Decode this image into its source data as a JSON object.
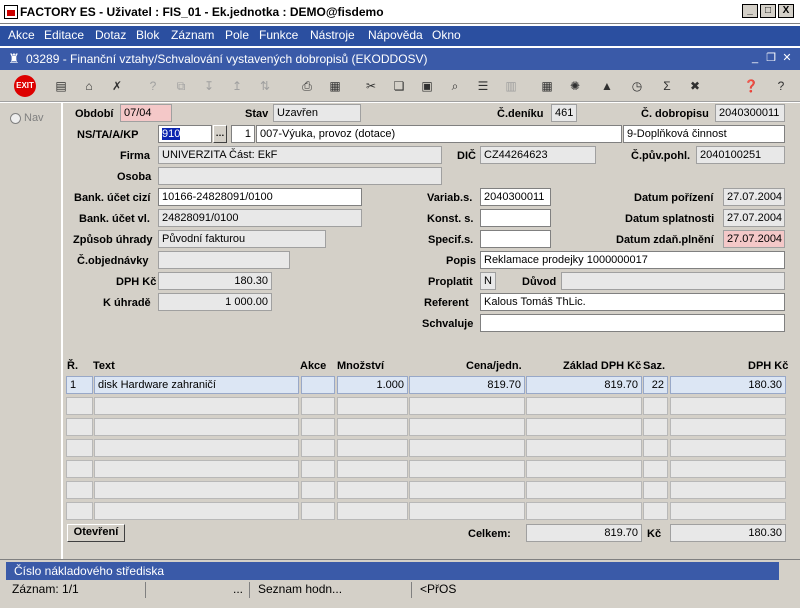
{
  "window": {
    "title": "FACTORY ES - Uživatel : FIS_01 - Ek.jednotka : DEMO@fisdemo",
    "min": "_",
    "max": "□",
    "close": "X"
  },
  "menu": [
    "Akce",
    "Editace",
    "Dotaz",
    "Blok",
    "Záznam",
    "Pole",
    "Funkce",
    "Nástroje",
    "Nápověda",
    "Okno"
  ],
  "doc": {
    "title": "03289 - Finanční vztahy/Schvalování vystavených dobropisů (EKODDOSV)"
  },
  "toolbar": {
    "exit": "EXIT",
    "icons": [
      "add-record-icon",
      "save-icon",
      "delete-record-icon",
      "help-doc-icon",
      "copy-record-icon",
      "sort-asc-icon",
      "sort-desc-icon",
      "sort-icon",
      "print-icon",
      "print-setup-icon",
      "cut-icon",
      "copy-icon",
      "paste-icon",
      "find-icon",
      "list-icon",
      "columns-icon",
      "calculator-icon",
      "settings-icon",
      "chart-icon",
      "calendar-icon",
      "sum-icon",
      "excel-icon",
      "help-icon",
      "context-help-icon"
    ]
  },
  "nav": {
    "label": "Nav"
  },
  "form": {
    "obdobi": {
      "label": "Období",
      "value": "07/04"
    },
    "stav": {
      "label": "Stav",
      "value": "Uzavřen"
    },
    "cdeniku": {
      "label": "Č.deníku",
      "value": "461"
    },
    "cdobropisu": {
      "label": "Č. dobropisu",
      "value": "2040300011"
    },
    "nstakp": {
      "label": "NS/TA/A/KP",
      "ns": "910",
      "dots": "…",
      "ta": "1",
      "a": "007-Výuka, provoz (dotace)",
      "kp": "9-Doplňková činnost"
    },
    "firma": {
      "label": "Firma",
      "value": "UNIVERZITA Část: EkF"
    },
    "dic": {
      "label": "DIČ",
      "value": "CZ44264623"
    },
    "cpuvpohl": {
      "label": "Č.pův.pohl.",
      "value": "2040100251"
    },
    "osoba": {
      "label": "Osoba",
      "value": ""
    },
    "bankcizi": {
      "label": "Bank. účet cizí",
      "value": "10166-24828091/0100"
    },
    "variabs": {
      "label": "Variab.s.",
      "value": "2040300011"
    },
    "datporizeni": {
      "label": "Datum pořízení",
      "value": "27.07.2004"
    },
    "bankvl": {
      "label": "Bank. účet vl.",
      "value": "24828091/0100"
    },
    "konsts": {
      "label": "Konst. s.",
      "value": ""
    },
    "datsplatnosti": {
      "label": "Datum splatnosti",
      "value": "27.07.2004"
    },
    "zpusobuhrady": {
      "label": "Způsob úhrady",
      "value": "Původní fakturou"
    },
    "specifs": {
      "label": "Specif.s.",
      "value": ""
    },
    "datzdan": {
      "label": "Datum zdaň.plnění",
      "value": "27.07.2004"
    },
    "cobjednavky": {
      "label": "Č.objednávky",
      "value": ""
    },
    "popis": {
      "label": "Popis",
      "value": "Reklamace prodejky 1000000017"
    },
    "dphkc": {
      "label": "DPH Kč",
      "value": "180.30"
    },
    "proplatit": {
      "label": "Proplatit",
      "value": "N"
    },
    "duvod": {
      "label": "Důvod",
      "value": ""
    },
    "kuhrade": {
      "label": "K úhradě",
      "value": "1 000.00"
    },
    "referent": {
      "label": "Referent",
      "value": "Kalous Tomáš ThLic."
    },
    "schvaluje": {
      "label": "Schvaluje",
      "value": ""
    }
  },
  "table": {
    "headers": {
      "r": "Ř.",
      "text": "Text",
      "akce": "Akce",
      "mnozstvi": "Množství",
      "cena": "Cena/jedn.",
      "zaklad": "Základ DPH Kč",
      "saz": "Saz.",
      "dph": "DPH Kč"
    },
    "rows": [
      {
        "r": "1",
        "text": "disk Hardware zahraničí",
        "akce": "",
        "mnozstvi": "1.000",
        "cena": "819.70",
        "zaklad": "819.70",
        "saz": "22",
        "dph": "180.30"
      }
    ],
    "open_button": "Otevření",
    "total_label": "Celkem:",
    "total_zaklad": "819.70",
    "currency": "Kč",
    "total_dph": "180.30"
  },
  "status": {
    "hint": "Číslo nákladového střediska",
    "record": "Záznam: 1/1",
    "ellipsis": "...",
    "list": "Seznam hodn...",
    "mode": "<PřOS"
  }
}
